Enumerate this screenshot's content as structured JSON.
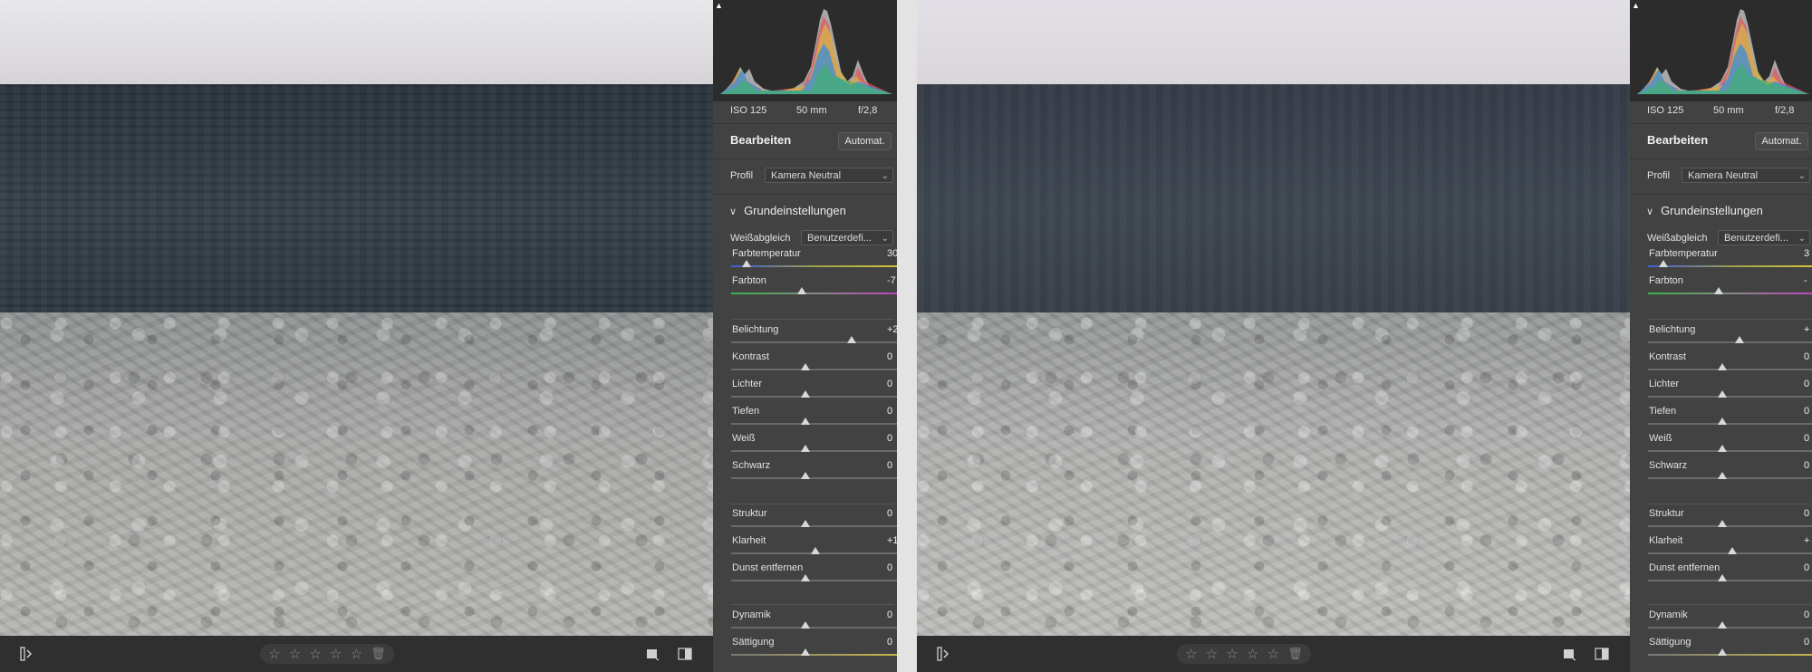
{
  "colors": {
    "panel_bg": "#424242",
    "histogram_bg": "#2c2c2c",
    "toolbar_bg": "#2f2f2f"
  },
  "views": [
    {
      "meta": {
        "iso": "ISO 125",
        "focal": "50 mm",
        "aperture": "f/2,8"
      },
      "edit_title": "Bearbeiten",
      "auto_button": "Automat.",
      "profile_label": "Profil",
      "profile_value": "Kamera Neutral",
      "section_title": "Grundeinstellungen",
      "wb_label": "Weißabgleich",
      "wb_value": "Benutzerdefi...",
      "sliders": [
        {
          "label": "Farbtemperatur",
          "value": "30",
          "level": 0.09
        },
        {
          "label": "Farbton",
          "value": "-7",
          "level": 0.41
        },
        {
          "label": "Belichtung",
          "value": "+2",
          "level": 0.7
        },
        {
          "label": "Kontrast",
          "value": "0",
          "level": 0.43
        },
        {
          "label": "Lichter",
          "value": "0",
          "level": 0.43
        },
        {
          "label": "Tiefen",
          "value": "0",
          "level": 0.43
        },
        {
          "label": "Weiß",
          "value": "0",
          "level": 0.43
        },
        {
          "label": "Schwarz",
          "value": "0",
          "level": 0.43
        },
        {
          "label": "Struktur",
          "value": "0",
          "level": 0.43
        },
        {
          "label": "Klarheit",
          "value": "+1",
          "level": 0.49
        },
        {
          "label": "Dunst entfernen",
          "value": "0",
          "level": 0.43
        },
        {
          "label": "Dynamik",
          "value": "0",
          "level": 0.43
        },
        {
          "label": "Sättigung",
          "value": "0",
          "level": 0.43
        }
      ],
      "rating_stars": 0
    },
    {
      "meta": {
        "iso": "ISO 125",
        "focal": "50 mm",
        "aperture": "f/2,8"
      },
      "edit_title": "Bearbeiten",
      "auto_button": "Automat.",
      "profile_label": "Profil",
      "profile_value": "Kamera Neutral",
      "section_title": "Grundeinstellungen",
      "wb_label": "Weißabgleich",
      "wb_value": "Benutzerdefi...",
      "sliders": [
        {
          "label": "Farbtemperatur",
          "value": "3",
          "level": 0.09
        },
        {
          "label": "Farbton",
          "value": "-",
          "level": 0.41
        },
        {
          "label": "Belichtung",
          "value": "+",
          "level": 0.53
        },
        {
          "label": "Kontrast",
          "value": "0",
          "level": 0.43
        },
        {
          "label": "Lichter",
          "value": "0",
          "level": 0.43
        },
        {
          "label": "Tiefen",
          "value": "0",
          "level": 0.43
        },
        {
          "label": "Weiß",
          "value": "0",
          "level": 0.43
        },
        {
          "label": "Schwarz",
          "value": "0",
          "level": 0.43
        },
        {
          "label": "Struktur",
          "value": "0",
          "level": 0.43
        },
        {
          "label": "Klarheit",
          "value": "+",
          "level": 0.49
        },
        {
          "label": "Dunst entfernen",
          "value": "0",
          "level": 0.43
        },
        {
          "label": "Dynamik",
          "value": "0",
          "level": 0.43
        },
        {
          "label": "Sättigung",
          "value": "0",
          "level": 0.43
        }
      ],
      "rating_stars": 0
    }
  ]
}
